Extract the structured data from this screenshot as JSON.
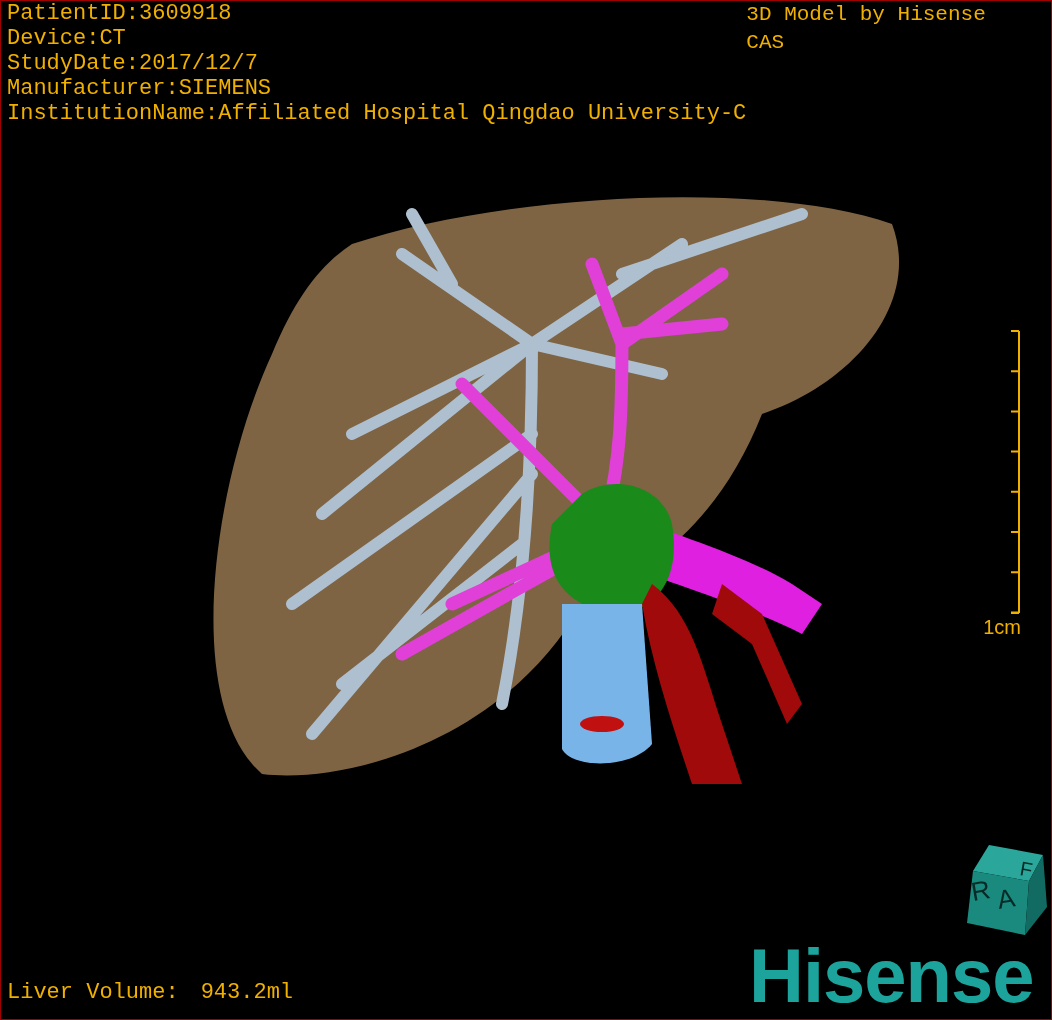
{
  "info_lines": [
    "PatientID:3609918",
    "Device:CT",
    "StudyDate:2017/12/7",
    "Manufacturer:SIEMENS",
    "InstitutionName:Affiliated Hospital Qingdao University-C"
  ],
  "model_credit": "3D Model by Hisense CAS",
  "scale_bar": {
    "label": "1cm"
  },
  "liver_volume": {
    "label": "Liver Volume:",
    "value": "943.2ml"
  },
  "orientation_cube": {
    "labels": [
      "R",
      "A",
      "F"
    ]
  },
  "logo": "Hisense"
}
